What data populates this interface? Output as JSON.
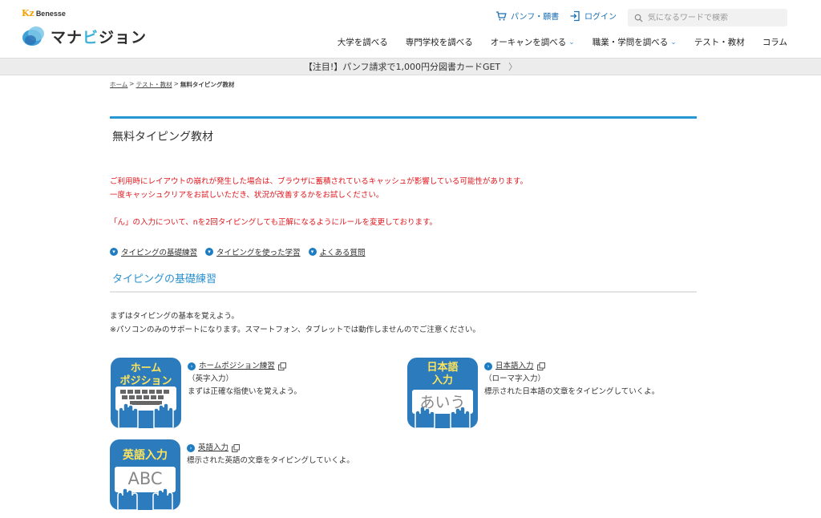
{
  "header": {
    "brand_small_mark": "Kz",
    "brand_small_name": "Benesse",
    "logo_text_a": "マナ",
    "logo_text_b": "ビ",
    "logo_text_c": "ジョン",
    "pamphlet_label": "パンフ・願書",
    "login_label": "ログイン",
    "search_placeholder": "気になるワードで検索"
  },
  "gnav": [
    {
      "label": "大学を調べる",
      "chevron": false
    },
    {
      "label": "専門学校を調べる",
      "chevron": false
    },
    {
      "label": "オーキャンを調べる",
      "chevron": true
    },
    {
      "label": "職業・学問を調べる",
      "chevron": true
    },
    {
      "label": "テスト・教材",
      "chevron": false
    },
    {
      "label": "コラム",
      "chevron": false
    }
  ],
  "notice_bar": {
    "text": "【注目!】パンフ請求で1,000円分図書カードGET",
    "arrow": "〉"
  },
  "breadcrumb": {
    "home": "ホーム",
    "sep1": ">",
    "parent": "テスト・教材",
    "sep2": ">",
    "current": "無料タイピング教材"
  },
  "page_title": "無料タイピング教材",
  "warnings": {
    "line1": "ご利用時にレイアウトの崩れが発生した場合は、ブラウザに蓄積されているキャッシュが影響している可能性があります。",
    "line2": "一度キャッシュクリアをお試しいただき、状況が改善するかをお試しください。",
    "line3": "「ん」の入力について、nを2回タイピングしても正解になるようにルールを変更しております。"
  },
  "anchors": [
    "タイピングの基礎練習",
    "タイピングを使った学習",
    "よくある質問"
  ],
  "section_title": "タイピングの基礎練習",
  "intro": {
    "line1": "まずはタイピングの基本を覚えよう。",
    "line2": "※パソコンのみのサポートになります。スマートフォン、タブレットでは動作しませんのでご注意ください。"
  },
  "cards": [
    {
      "icon_line1": "ホーム",
      "icon_line2": "ポジション",
      "link": "ホームポジション練習",
      "sub": "（英字入力）",
      "desc": "まずは正確な指使いを覚えよう。"
    },
    {
      "icon_line1": "日本語",
      "icon_line2": "入力",
      "icon_sample": "あいう",
      "link": "日本語入力",
      "sub": "（ローマ字入力）",
      "desc": "標示された日本語の文章をタイピングしていくよ。"
    },
    {
      "icon_line1": "英語入力",
      "icon_sample": "ABC",
      "link": "英語入力",
      "desc": "標示された英語の文章をタイピングしていくよ。"
    }
  ],
  "colors": {
    "accent_blue": "#2a96d3",
    "warning_red": "#e0161c",
    "icon_blue": "#2b7bbd",
    "icon_yellow": "#ffe45c"
  }
}
